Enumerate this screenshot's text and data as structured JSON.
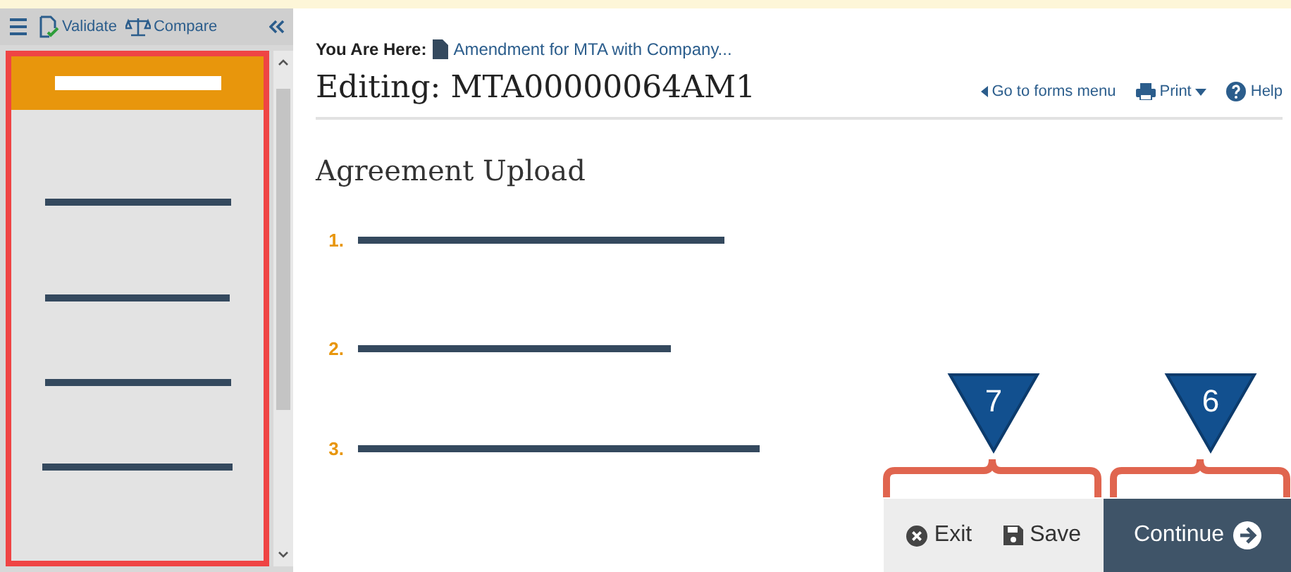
{
  "toolbar": {
    "validate": "Validate",
    "compare": "Compare"
  },
  "sidebar": {
    "items": [
      {
        "selected": true
      },
      {
        "selected": false
      },
      {
        "selected": false
      },
      {
        "selected": false
      },
      {
        "selected": false
      }
    ]
  },
  "breadcrumb": {
    "label": "You Are Here:",
    "link": "Amendment for MTA with Company..."
  },
  "title": "Editing: MTA00000064AM1",
  "header_links": {
    "forms_menu": "Go to forms menu",
    "print": "Print",
    "help": "Help"
  },
  "section_title": "Agreement Upload",
  "steps": [
    {
      "number": "1."
    },
    {
      "number": "2."
    },
    {
      "number": "3."
    }
  ],
  "footer": {
    "exit": "Exit",
    "save": "Save",
    "continue": "Continue"
  },
  "callouts": [
    {
      "number": "7"
    },
    {
      "number": "6"
    }
  ]
}
